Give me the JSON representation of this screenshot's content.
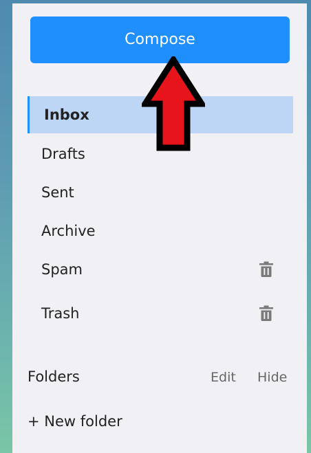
{
  "compose": {
    "label": "Compose"
  },
  "nav": [
    {
      "label": "Inbox",
      "active": true
    },
    {
      "label": "Drafts"
    },
    {
      "label": "Sent"
    },
    {
      "label": "Archive"
    },
    {
      "label": "Spam",
      "icon": "trash-icon"
    },
    {
      "label": "Trash",
      "icon": "trash-icon"
    }
  ],
  "folders": {
    "label": "Folders",
    "edit_label": "Edit",
    "hide_label": "Hide",
    "new_folder_label": "+ New folder"
  },
  "annotation": {
    "icon": "up-arrow-icon",
    "fill": "#e8141c",
    "stroke": "#000000"
  },
  "colors": {
    "accent": "#1e8ffd",
    "active_bg": "#bdd6f6",
    "panel_bg": "#f0f0f5"
  }
}
